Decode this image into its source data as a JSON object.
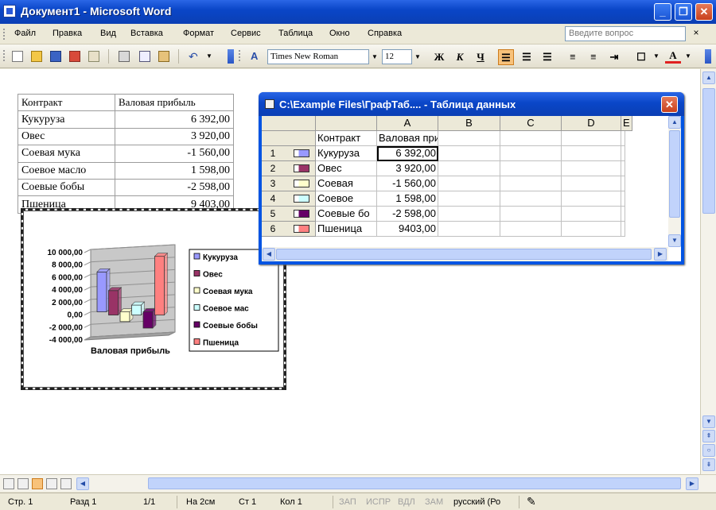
{
  "window": {
    "title": "Документ1 - Microsoft Word"
  },
  "menu": {
    "items": [
      "Файл",
      "Правка",
      "Вид",
      "Вставка",
      "Формат",
      "Сервис",
      "Таблица",
      "Окно",
      "Справка"
    ],
    "question_placeholder": "Введите вопрос"
  },
  "toolbar": {
    "font_name": "Times New Roman",
    "font_size": "12",
    "bold": "Ж",
    "italic": "К",
    "underline": "Ч",
    "font_color_label": "A"
  },
  "word_table": {
    "headers": [
      "Контракт",
      "Валовая прибыль"
    ],
    "rows": [
      [
        "Кукуруза",
        "6 392,00"
      ],
      [
        "Овес",
        "3 920,00"
      ],
      [
        "Соевая мука",
        "-1 560,00"
      ],
      [
        "Соевое масло",
        "1 598,00"
      ],
      [
        "Соевые бобы",
        "-2 598,00"
      ],
      [
        "Пшеница",
        "9 403,00"
      ]
    ]
  },
  "chart_data": {
    "type": "bar",
    "title": "",
    "xlabel": "Валовая прибыль",
    "ylabel": "",
    "ylim": [
      -4000,
      10000
    ],
    "yticks": [
      "10 000,00",
      "8 000,00",
      "6 000,00",
      "4 000,00",
      "2 000,00",
      "0,00",
      "-2 000,00",
      "-4 000,00"
    ],
    "categories": [
      "Валовая прибыль"
    ],
    "legend_position": "right",
    "series": [
      {
        "name": "Кукуруза",
        "values": [
          6392
        ],
        "color": "#9999ff"
      },
      {
        "name": "Овес",
        "values": [
          3920
        ],
        "color": "#993366"
      },
      {
        "name": "Соевая мука",
        "values": [
          -1560
        ],
        "color": "#ffffcc"
      },
      {
        "name": "Соевое мас",
        "values": [
          1598
        ],
        "color": "#ccffff"
      },
      {
        "name": "Соевые бобы",
        "values": [
          -2598
        ],
        "color": "#660066"
      },
      {
        "name": "Пшеница",
        "values": [
          9403
        ],
        "color": "#ff8080"
      }
    ]
  },
  "datasheet": {
    "title": "C:\\Example Files\\ГрафТаб.... - Таблица данных",
    "columns": [
      "A",
      "B",
      "C",
      "D",
      "E"
    ],
    "header_row": [
      "Контракт",
      "Валовая прибыль"
    ],
    "rows": [
      {
        "num": "1",
        "label": "Кукуруза",
        "value": "6 392,00"
      },
      {
        "num": "2",
        "label": "Овес",
        "value": "3 920,00"
      },
      {
        "num": "3",
        "label": "Соевая",
        "value": "-1 560,00"
      },
      {
        "num": "4",
        "label": "Соевое",
        "value": "1 598,00"
      },
      {
        "num": "5",
        "label": "Соевые бо",
        "value": "-2 598,00"
      },
      {
        "num": "6",
        "label": "Пшеница",
        "value": "9403,00"
      }
    ],
    "close_label": "✕"
  },
  "status": {
    "page": "Стр. 1",
    "section": "Разд 1",
    "pages": "1/1",
    "position": "На 2см",
    "line": "Ст 1",
    "col": "Кол 1",
    "rec": "ЗАП",
    "trk": "ИСПР",
    "ext": "ВДЛ",
    "ovr": "ЗАМ",
    "language": "русский (Ро"
  }
}
